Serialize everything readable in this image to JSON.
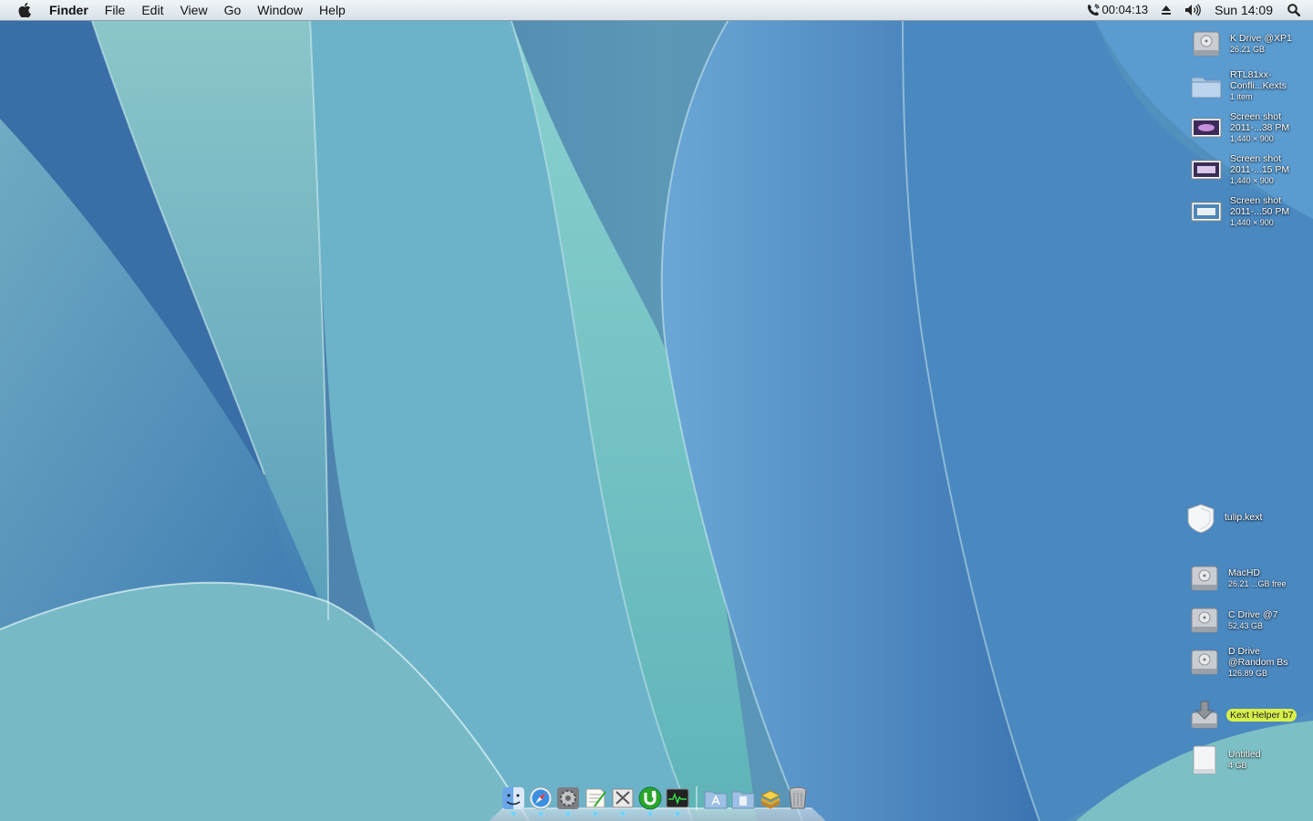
{
  "menubar": {
    "apple_icon": "apple-logo-icon",
    "app_name": "Finder",
    "menus": [
      "File",
      "Edit",
      "View",
      "Go",
      "Window",
      "Help"
    ],
    "status": {
      "call_timer": "00:04:13",
      "clock": "Sun 14:09",
      "icons": [
        "phone-icon",
        "eject-icon",
        "volume-icon",
        "spotlight-search-icon"
      ]
    }
  },
  "desktop_items": [
    {
      "name": "K Drive @XP1",
      "lines": [
        "K Drive @XP1"
      ],
      "sub": "26.21 GB",
      "icon": "hard-drive-icon"
    },
    {
      "name": "RTL81xx-Confli...Kexts",
      "lines": [
        "RTL81xx-",
        "Confli...Kexts"
      ],
      "sub": "1 item",
      "icon": "folder-icon"
    },
    {
      "name": "Screen shot 2011-...38 PM",
      "lines": [
        "Screen shot",
        "2011-...38 PM"
      ],
      "sub": "1,440 × 900",
      "icon": "screenshot-thumbnail-icon"
    },
    {
      "name": "Screen shot 2011-...15 PM",
      "lines": [
        "Screen shot",
        "2011-...15 PM"
      ],
      "sub": "1,440 × 900",
      "icon": "screenshot-thumbnail-icon"
    },
    {
      "name": "Screen shot 2011-...50 PM",
      "lines": [
        "Screen shot",
        "2011-...50 PM"
      ],
      "sub": "1,440 × 900",
      "icon": "screenshot-thumbnail-icon"
    },
    {
      "name": "tulip.kext",
      "lines": [
        "tulip.kext"
      ],
      "sub": "",
      "icon": "kext-bundle-icon"
    },
    {
      "name": "MacHD",
      "lines": [
        "MacHD"
      ],
      "sub": "26.21 ...GB free",
      "icon": "hard-drive-icon"
    },
    {
      "name": "C Drive @7",
      "lines": [
        "C Drive @7"
      ],
      "sub": "52.43 GB",
      "icon": "hard-drive-icon"
    },
    {
      "name": "D Drive @Random Bs",
      "lines": [
        "D Drive",
        "@Random Bs"
      ],
      "sub": "126.89 GB",
      "icon": "hard-drive-icon"
    },
    {
      "name": "Kext Helper b7",
      "lines": [
        "Kext Helper b7"
      ],
      "sub": "",
      "icon": "kext-helper-icon",
      "highlighted": true
    },
    {
      "name": "Untitled",
      "lines": [
        "Untitled"
      ],
      "sub": "4 GB",
      "icon": "removable-drive-icon"
    }
  ],
  "dock": {
    "apps": [
      {
        "name": "Finder",
        "icon": "finder-icon",
        "running": true
      },
      {
        "name": "Safari",
        "icon": "safari-icon",
        "running": true
      },
      {
        "name": "System Preferences",
        "icon": "system-preferences-icon",
        "running": true
      },
      {
        "name": "TextEdit",
        "icon": "textedit-icon",
        "running": true
      },
      {
        "name": "Script Editor",
        "icon": "script-editor-icon",
        "running": true
      },
      {
        "name": "uTorrent",
        "icon": "utorrent-icon",
        "running": true
      },
      {
        "name": "Activity Monitor",
        "icon": "activity-monitor-icon",
        "running": true
      }
    ],
    "stacks": [
      {
        "name": "Applications",
        "icon": "applications-folder-icon"
      },
      {
        "name": "Documents",
        "icon": "documents-folder-icon"
      },
      {
        "name": "Downloads",
        "icon": "downloads-stack-icon"
      },
      {
        "name": "Trash",
        "icon": "trash-icon"
      }
    ]
  },
  "colors": {
    "highlight": "#d8f046",
    "wallpaper_dark": "#2d5f95",
    "wallpaper_light": "#7fc3c7"
  }
}
